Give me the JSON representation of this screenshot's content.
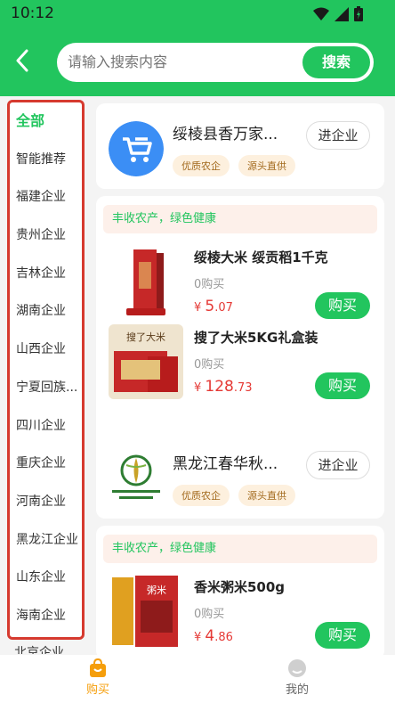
{
  "status": {
    "time": "10:12"
  },
  "search": {
    "placeholder": "请输入搜索内容",
    "button_label": "搜索"
  },
  "sidebar": {
    "items": [
      {
        "label": "全部"
      },
      {
        "label": "智能推荐"
      },
      {
        "label": "福建企业"
      },
      {
        "label": "贵州企业"
      },
      {
        "label": "吉林企业"
      },
      {
        "label": "湖南企业"
      },
      {
        "label": "山西企业"
      },
      {
        "label": "宁夏回族..."
      },
      {
        "label": "四川企业"
      },
      {
        "label": "重庆企业"
      },
      {
        "label": "河南企业"
      },
      {
        "label": "黑龙江企业"
      },
      {
        "label": "山东企业"
      },
      {
        "label": "海南企业"
      }
    ],
    "next_item_label": "北京企业"
  },
  "companies": [
    {
      "name": "绥棱县香万家...",
      "tags": [
        "优质农企",
        "源头直供"
      ],
      "enter_label": "进企业",
      "slogan": "丰收农产，绿色健康",
      "products": [
        {
          "name": "绥棱大米 绥贡稻1千克",
          "sold": "0购买",
          "currency": "¥",
          "price_int": "5",
          "price_dec": ".07",
          "buy_label": "购买"
        },
        {
          "name": "搜了大米5KG礼盒装",
          "sold": "0购买",
          "currency": "¥",
          "price_int": "128",
          "price_dec": ".73",
          "buy_label": "购买"
        }
      ]
    },
    {
      "name": "黑龙江春华秋...",
      "logo_text": "CHUNHUAQIUSHI 春华秋实",
      "tags": [
        "优质农企",
        "源头直供"
      ],
      "enter_label": "进企业",
      "slogan": "丰收农产，绿色健康",
      "products": [
        {
          "name": "香米粥米500g",
          "sold": "0购买",
          "currency": "¥",
          "price_int": "4",
          "price_dec": ".86",
          "buy_label": "购买"
        }
      ]
    }
  ],
  "product_images": {
    "p2_text": "搜了大米",
    "p3_text": "粥米"
  },
  "bottom_nav": {
    "tabs": [
      {
        "label": "购买"
      },
      {
        "label": "我的"
      }
    ]
  },
  "colors": {
    "primary": "#22c55e",
    "price": "#e53935",
    "highlight_border": "#d63a2f"
  }
}
